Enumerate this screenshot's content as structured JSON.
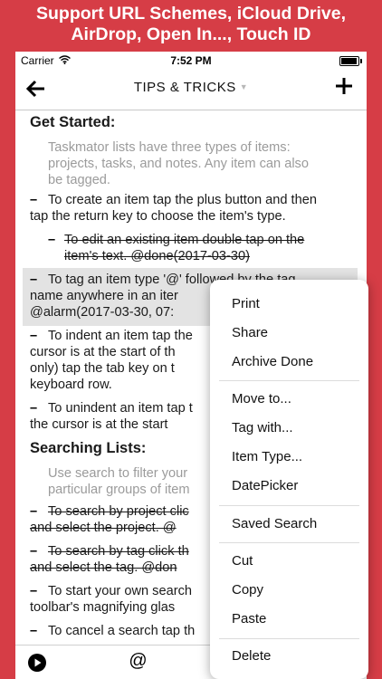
{
  "promo": {
    "line1": "Support URL Schemes, iCloud Drive,",
    "line2": "AirDrop, Open In..., Touch ID"
  },
  "status": {
    "carrier": "Carrier",
    "time": "7:52 PM"
  },
  "navbar": {
    "title": "TIPS & TRICKS"
  },
  "content": {
    "h1": "Get Started:",
    "note1": [
      "Taskmator lists have three types of items:",
      "projects, tasks, and notes. Any item can also",
      "be tagged."
    ],
    "task1": [
      "To create an item tap the plus button and then",
      "tap the return key to choose the item's type."
    ],
    "task1a": [
      "To edit an existing item double tap on the",
      "item's text. @done(2017-03-30)"
    ],
    "task2": [
      "To tag an item type '@' followed by the tag",
      "name anywhere in an iter",
      "@alarm(2017-03-30, 07:"
    ],
    "task3": [
      "To indent an item tap the",
      "cursor is at the start of th",
      "only) tap the tab key on t",
      "keyboard row."
    ],
    "task4": [
      "To unindent an item tap t",
      "the cursor is at the start"
    ],
    "h2": "Searching Lists:",
    "note2": [
      "Use search to filter your",
      "particular groups of item"
    ],
    "task5": [
      "To search by project clic",
      "and select the project. @"
    ],
    "task6": [
      "To search by tag click th",
      "and select the tag. @don"
    ],
    "task7": [
      "To start your own search",
      "toolbar's magnifying glas"
    ],
    "task8": [
      "To cancel a search tap th"
    ]
  },
  "menu": {
    "items": [
      "Print",
      "Share",
      "Archive Done",
      "Move to...",
      "Tag with...",
      "Item Type...",
      "DatePicker",
      "Saved Search",
      "Cut",
      "Copy",
      "Paste",
      "Delete"
    ]
  }
}
